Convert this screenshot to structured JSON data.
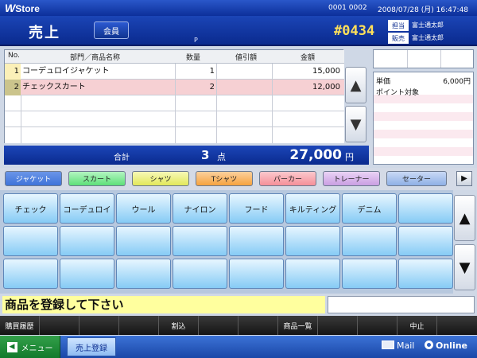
{
  "titlebar": {
    "app_name": "Store",
    "app_initial": "W",
    "terminal": "0001 0002",
    "datetime": "2008/07/28 (月) 16:47:48"
  },
  "header": {
    "mode_title": "売上",
    "member_button": "会員",
    "p_mark": "P",
    "receipt_no": "#0434",
    "staff": [
      {
        "tag": "担当",
        "name": "富士通太郎"
      },
      {
        "tag": "販売",
        "name": "富士通太郎"
      }
    ]
  },
  "table": {
    "columns": {
      "no": "No.",
      "name": "部門／商品名称",
      "qty": "数量",
      "discount": "値引額",
      "amount": "金額"
    },
    "rows": [
      {
        "index": "1",
        "name": "コーデュロイジャケット",
        "qty": "1",
        "discount": "",
        "amount": "15,000"
      },
      {
        "index": "2",
        "name": "チェックスカート",
        "qty": "2",
        "discount": "",
        "amount": "12,000"
      }
    ]
  },
  "total": {
    "label": "合計",
    "count": "3",
    "count_unit": "点",
    "amount": "27,000",
    "currency": "円"
  },
  "info_panel": {
    "unit_price_label": "単価",
    "unit_price": "6,000円",
    "points_label": "ポイント対象"
  },
  "categories": [
    {
      "label": "ジャケット",
      "color": "#3f73d9"
    },
    {
      "label": "スカート",
      "color": "#5ee079"
    },
    {
      "label": "シャツ",
      "color": "#e2e85a"
    },
    {
      "label": "Tシャツ",
      "color": "#f6a23e"
    },
    {
      "label": "パーカー",
      "color": "#f58f98"
    },
    {
      "label": "トレーナー",
      "color": "#c99ee2"
    },
    {
      "label": "セーター",
      "color": "#8fb0e6"
    }
  ],
  "products": [
    "チェック",
    "コーデュロイ",
    "ウール",
    "ナイロン",
    "フード",
    "キルティング",
    "デニム"
  ],
  "message": "商品を登録して下さい",
  "function_keys": [
    "購買履歴",
    "",
    "",
    "",
    "割込",
    "",
    "",
    "商品一覧",
    "",
    "",
    "中止",
    ""
  ],
  "taskbar": {
    "menu": "メニュー",
    "task": "売上登録",
    "mail": "Mail",
    "online": "Online"
  }
}
